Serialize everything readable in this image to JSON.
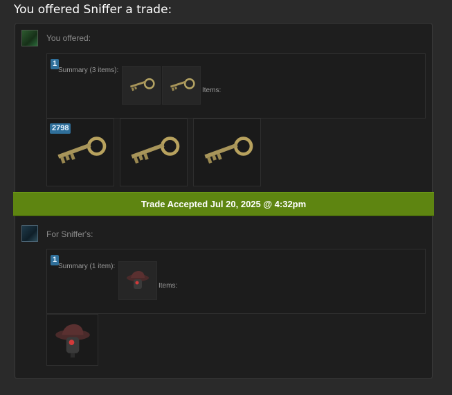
{
  "page_title": "You offered Sniffer a trade:",
  "you_offered": {
    "label": "You offered:",
    "summary_count": "1",
    "summary_label": "Summary (3 items):",
    "items_label": "Items:",
    "first_item_quantity": "2798",
    "item_icons": [
      "key-icon",
      "key-icon",
      "key-icon"
    ]
  },
  "status": {
    "accepted_text": "Trade Accepted Jul 20, 2025 @ 4:32pm",
    "color": "#5e8511"
  },
  "for_sniffer": {
    "label": "For Sniffer's:",
    "summary_count": "1",
    "summary_label": "Summary (1 item):",
    "items_label": "Items:",
    "item_icons": [
      "hat-icon"
    ]
  }
}
